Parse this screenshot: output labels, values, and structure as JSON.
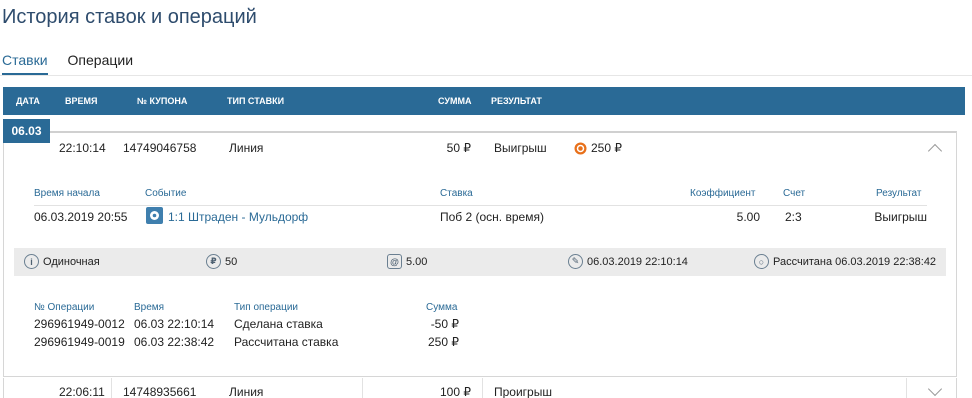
{
  "page": {
    "title": "История ставок и операций"
  },
  "tabs": [
    {
      "label": "Ставки",
      "active": true
    },
    {
      "label": "Операции",
      "active": false
    }
  ],
  "table": {
    "headers": [
      "Дата",
      "Время",
      "№ купона",
      "Тип ставки",
      "Сумма",
      "Результат"
    ]
  },
  "date_group": "06.03",
  "bet1": {
    "time": "22:10:14",
    "coupon": "14749046758",
    "type": "Линия",
    "amount": "50 ₽",
    "result": "Выигрыш",
    "win_amount": "250 ₽",
    "details": {
      "headers": [
        "Время начала",
        "Событие",
        "Ставка",
        "Коэффициент",
        "Счет",
        "Результат"
      ],
      "start": "06.03.2019 20:55",
      "event": "1:1 Штраден - Мульдорф",
      "bet": "Поб 2 (осн. время)",
      "coef": "5.00",
      "score": "2:3",
      "result": "Выигрыш"
    },
    "info": {
      "kind": "Одиночная",
      "stake": "50",
      "odds": "5.00",
      "placed": "06.03.2019 22:10:14",
      "settled": "Рассчитана 06.03.2019 22:38:42"
    },
    "operations": {
      "headers": [
        "№ Операции",
        "Время",
        "Тип операции",
        "Сумма"
      ],
      "rows": [
        {
          "id": "296961949-0012",
          "time": "06.03 22:10:14",
          "type": "Сделана ставка",
          "sum": "-50 ₽"
        },
        {
          "id": "296961949-0019",
          "time": "06.03 22:38:42",
          "type": "Рассчитана ставка",
          "sum": "250 ₽"
        }
      ]
    }
  },
  "bet2": {
    "time": "22:06:11",
    "coupon": "14748935661",
    "type": "Линия",
    "amount": "100 ₽",
    "result": "Проигрыш"
  },
  "colors": {
    "header_bg": "#2a6a96",
    "title": "#2e4c6d",
    "info_bar": "#ebebeb",
    "win_coin": "#e8701a"
  },
  "icons": [
    "info-icon",
    "ruble-icon",
    "at-icon",
    "clock-icon",
    "status-icon",
    "event-icon",
    "coin-icon",
    "chevron-up-icon",
    "chevron-down-icon"
  ]
}
